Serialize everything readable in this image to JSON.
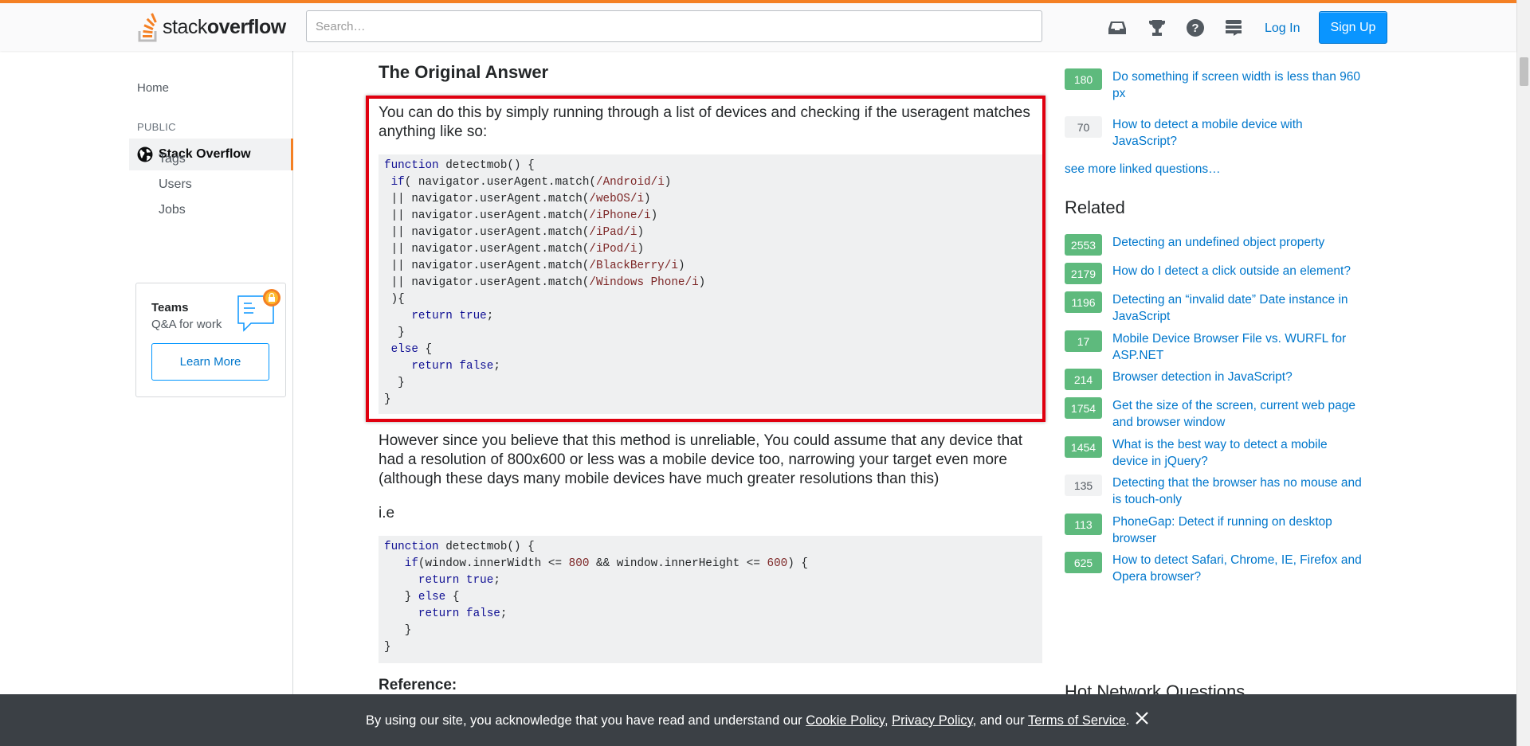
{
  "header": {
    "logo_light": "stack",
    "logo_bold": "overflow",
    "search_placeholder": "Search…",
    "icons": [
      "inbox-icon",
      "achievements-icon",
      "help-icon",
      "stack-exchange-icon"
    ],
    "login_label": "Log In",
    "signup_label": "Sign Up",
    "accent_color": "#f48024",
    "signup_color": "#0a95ff"
  },
  "leftnav": {
    "home": "Home",
    "public_label": "PUBLIC",
    "active_item": "Stack Overflow",
    "sub_items": [
      "Tags",
      "Users",
      "Jobs"
    ],
    "teams_title": "Teams",
    "teams_subtitle": "Q&A for work",
    "teams_button": "Learn More"
  },
  "answer": {
    "heading": "The Original Answer",
    "intro": "You can do this by simply running through a list of devices and checking if the useragent matches anything like so:",
    "code1": [
      "function detectmob() {",
      " if( navigator.userAgent.match(/Android/i)",
      " || navigator.userAgent.match(/webOS/i)",
      " || navigator.userAgent.match(/iPhone/i)",
      " || navigator.userAgent.match(/iPad/i)",
      " || navigator.userAgent.match(/iPod/i)",
      " || navigator.userAgent.match(/BlackBerry/i)",
      " || navigator.userAgent.match(/Windows Phone/i)",
      " ){",
      "    return true;",
      "  }",
      " else {",
      "    return false;",
      "  }",
      "}"
    ],
    "however": "However since you believe that this method is unreliable, You could assume that any device that had a resolution of 800x600 or less was a mobile device too, narrowing your target even more (although these days many mobile devices have much greater resolutions than this)",
    "ie": "i.e",
    "code2": [
      "function detectmob() {",
      "   if(window.innerWidth <= 800 && window.innerHeight <= 600) {",
      "     return true;",
      "   } else {",
      "     return false;",
      "   }",
      "}"
    ],
    "reference_heading": "Reference:",
    "highlight_color": "#e0000f"
  },
  "sidebar": {
    "linked": [
      {
        "votes": "180",
        "style": "green",
        "title": "Do something if screen width is less than 960 px"
      },
      {
        "votes": "70",
        "style": "grey",
        "title": "How to detect a mobile device with JavaScript?"
      }
    ],
    "see_more": "see more linked questions…",
    "related_heading": "Related",
    "related": [
      {
        "votes": "2553",
        "style": "green",
        "title": "Detecting an undefined object property"
      },
      {
        "votes": "2179",
        "style": "green",
        "title": "How do I detect a click outside an element?"
      },
      {
        "votes": "1196",
        "style": "green",
        "title": "Detecting an “invalid date” Date instance in JavaScript"
      },
      {
        "votes": "17",
        "style": "green",
        "title": "Mobile Device Browser File vs. WURFL for ASP.NET"
      },
      {
        "votes": "214",
        "style": "green",
        "title": "Browser detection in JavaScript?"
      },
      {
        "votes": "1754",
        "style": "green",
        "title": "Get the size of the screen, current web page and browser window"
      },
      {
        "votes": "1454",
        "style": "green",
        "title": "What is the best way to detect a mobile device in jQuery?"
      },
      {
        "votes": "135",
        "style": "grey",
        "title": "Detecting that the browser has no mouse and is touch-only"
      },
      {
        "votes": "113",
        "style": "green",
        "title": "PhoneGap: Detect if running on desktop browser"
      },
      {
        "votes": "625",
        "style": "green",
        "title": "How to detect Safari, Chrome, IE, Firefox and Opera browser?"
      }
    ],
    "hot_heading": "Hot Network Questions"
  },
  "cookie": {
    "prefix": "By using our site, you acknowledge that you have read and understand our ",
    "cookie_policy": "Cookie Policy",
    "sep1": ", ",
    "privacy_policy": "Privacy Policy",
    "sep2": ", and our ",
    "terms": "Terms of Service",
    "suffix": "."
  }
}
